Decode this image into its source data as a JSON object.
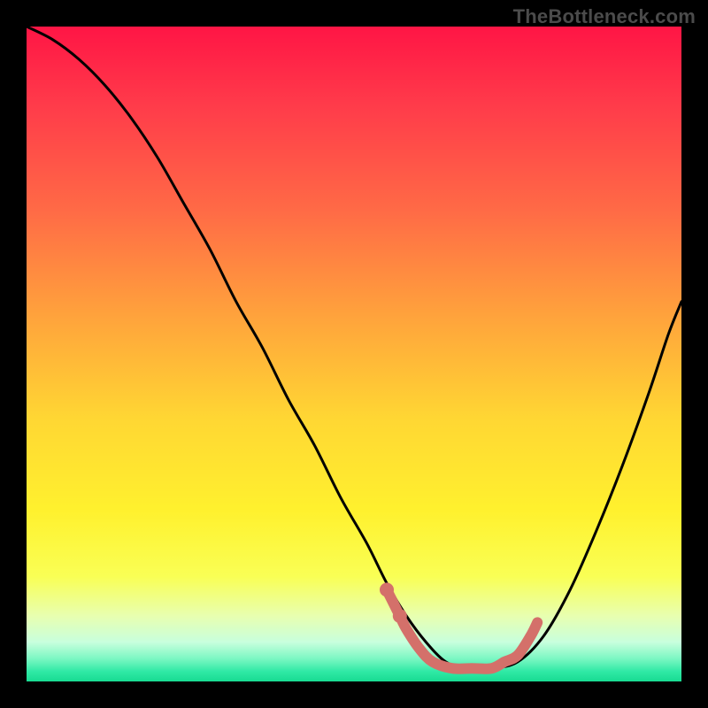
{
  "watermark": "TheBottleneck.com",
  "colors": {
    "page_bg": "#000000",
    "watermark": "#4b4b4b",
    "curve": "#000000",
    "highlight": "#d4706a",
    "gradient_stops": [
      {
        "offset": 0.0,
        "color": "#ff1545"
      },
      {
        "offset": 0.12,
        "color": "#ff3b4a"
      },
      {
        "offset": 0.28,
        "color": "#ff6a46"
      },
      {
        "offset": 0.44,
        "color": "#ffa23c"
      },
      {
        "offset": 0.6,
        "color": "#ffd733"
      },
      {
        "offset": 0.74,
        "color": "#fff12e"
      },
      {
        "offset": 0.84,
        "color": "#f9ff55"
      },
      {
        "offset": 0.9,
        "color": "#e8ffb0"
      },
      {
        "offset": 0.94,
        "color": "#c8ffdd"
      },
      {
        "offset": 0.965,
        "color": "#7cf7c3"
      },
      {
        "offset": 0.985,
        "color": "#2fe9a5"
      },
      {
        "offset": 1.0,
        "color": "#18db92"
      }
    ]
  },
  "chart_data": {
    "type": "line",
    "title": "",
    "xlabel": "",
    "ylabel": "",
    "xlim": [
      0,
      100
    ],
    "ylim": [
      0,
      100
    ],
    "series": [
      {
        "name": "bottleneck-curve",
        "x": [
          0,
          4,
          8,
          12,
          16,
          20,
          24,
          28,
          32,
          36,
          40,
          44,
          48,
          52,
          55,
          58,
          61,
          64,
          67,
          71,
          75,
          79,
          83,
          87,
          91,
          95,
          98,
          100
        ],
        "y": [
          100,
          98,
          95,
          91,
          86,
          80,
          73,
          66,
          58,
          51,
          43,
          36,
          28,
          21,
          15,
          10,
          6,
          3,
          2,
          2,
          3,
          7,
          14,
          23,
          33,
          44,
          53,
          58
        ]
      }
    ],
    "highlight_segment": {
      "name": "optimal-range-marker",
      "points": [
        {
          "x": 55,
          "y": 14
        },
        {
          "x": 56,
          "y": 12
        },
        {
          "x": 57,
          "y": 10
        },
        {
          "x": 58,
          "y": 8
        },
        {
          "x": 60,
          "y": 5
        },
        {
          "x": 62,
          "y": 3
        },
        {
          "x": 65,
          "y": 2
        },
        {
          "x": 68,
          "y": 2
        },
        {
          "x": 71,
          "y": 2
        },
        {
          "x": 73,
          "y": 3
        },
        {
          "x": 75,
          "y": 4
        },
        {
          "x": 77,
          "y": 7
        },
        {
          "x": 78,
          "y": 9
        }
      ]
    }
  }
}
